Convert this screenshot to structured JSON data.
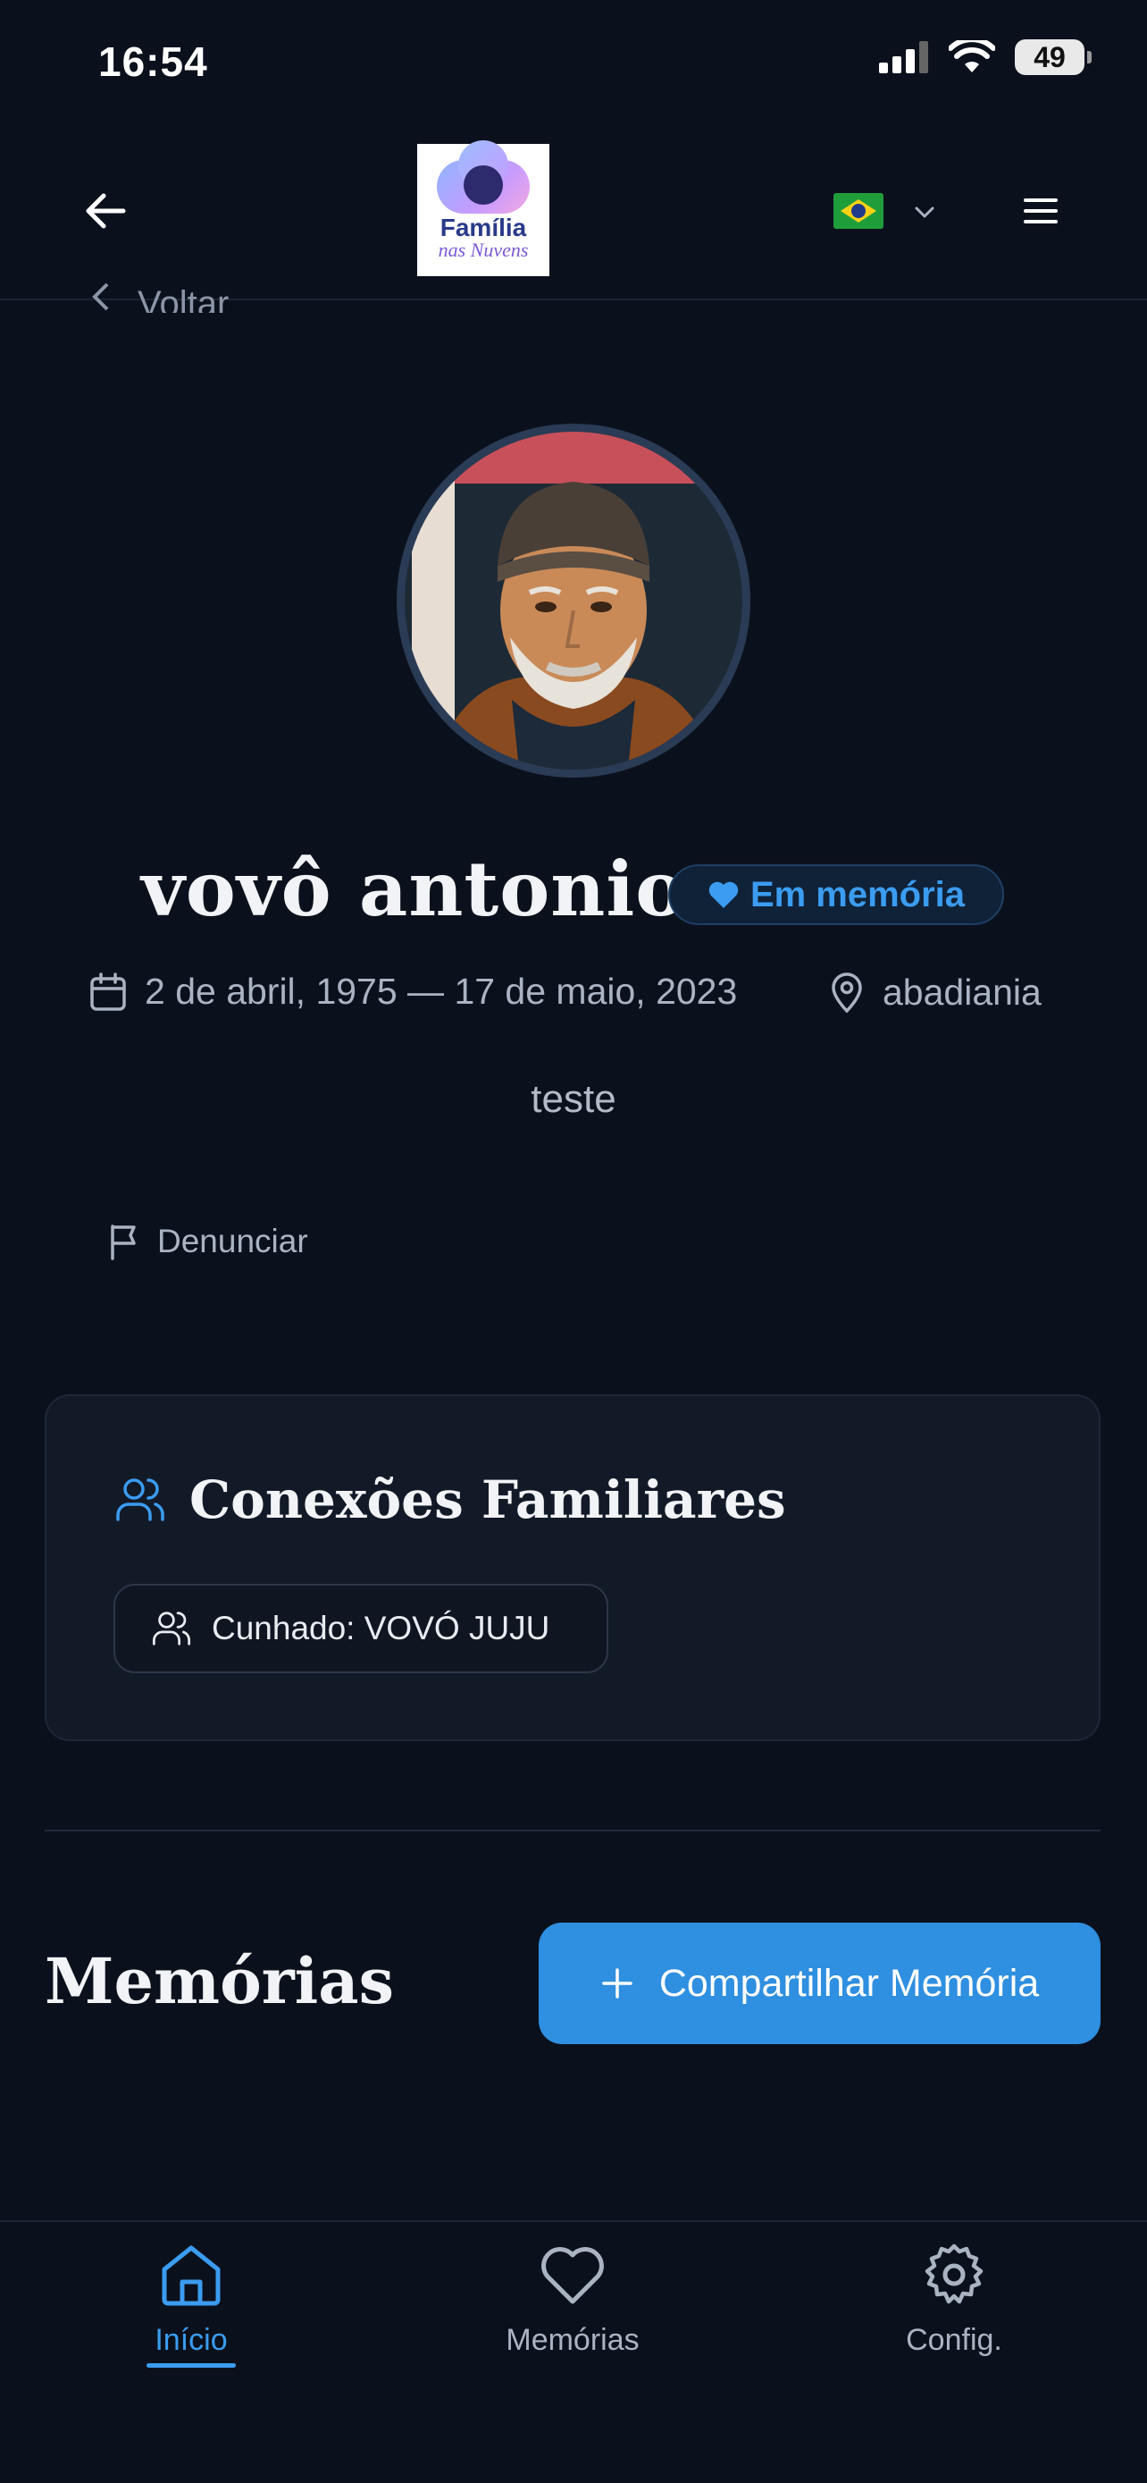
{
  "status_bar": {
    "time": "16:54",
    "battery": "49"
  },
  "header": {
    "logo_text": "Família",
    "logo_sub": "nas Nuvens",
    "language_flag": "brazil-flag-icon"
  },
  "back_link": {
    "label": "Voltar"
  },
  "profile": {
    "name": "vovô antonio",
    "badge": "Em memória",
    "dates": "2 de abril, 1975 — 17 de maio, 2023",
    "location": "abadiania",
    "bio": "teste",
    "report_label": "Denunciar"
  },
  "connections": {
    "title": "Conexões Familiares",
    "items": [
      {
        "label": "Cunhado: VOVÓ JUJU"
      }
    ]
  },
  "memories": {
    "title": "Memórias",
    "share_button": "Compartilhar Memória"
  },
  "bottom_nav": {
    "items": [
      {
        "label": "Início",
        "icon": "home-icon",
        "active": true
      },
      {
        "label": "Memórias",
        "icon": "heart-icon",
        "active": false
      },
      {
        "label": "Config.",
        "icon": "gear-icon",
        "active": false
      }
    ]
  },
  "colors": {
    "accent": "#3b9cf0",
    "background": "#0b111c",
    "card": "#121a28"
  }
}
